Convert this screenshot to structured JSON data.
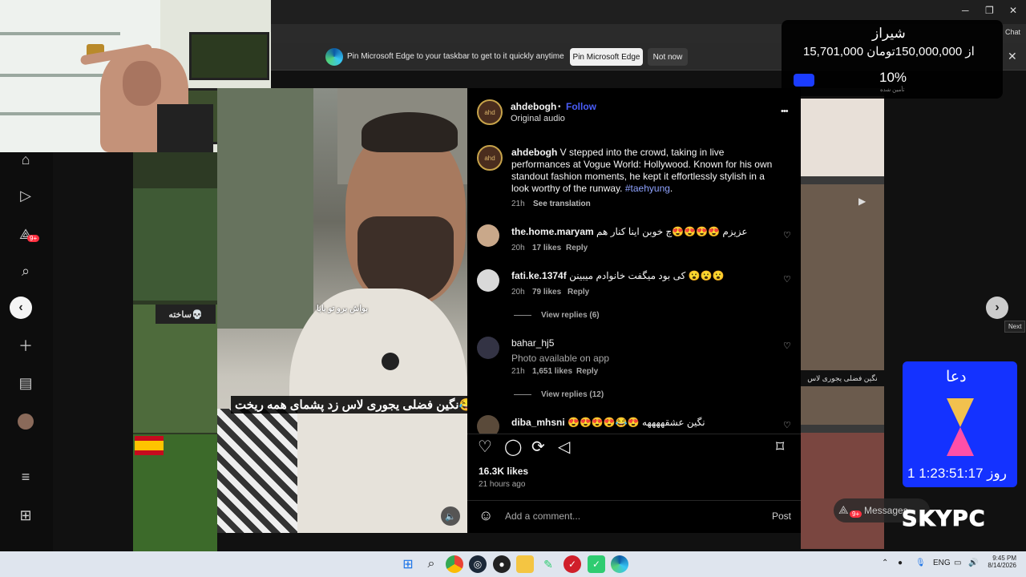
{
  "browser": {
    "edge_bar": {
      "message": "Pin Microsoft Edge to your taskbar to get to it quickly anytime",
      "pin_label": "Pin Microsoft Edge",
      "not_now_label": "Not now"
    },
    "chat_label": "Chat"
  },
  "nav": {
    "notification_badge": "9+",
    "left_arrow": "‹",
    "right_arrow": "›",
    "next_tooltip": "Next"
  },
  "video": {
    "small_caption": "بواش برو تو بابا",
    "main_caption": "نگین فضلی یجوری لاس زد پشمای همه ریخت😂🔥",
    "grid_overlay_text": "ساخته💀",
    "grid_overlay_text2": "نگین فضلی یجوری لاس"
  },
  "post": {
    "author": "ahdebogh",
    "follow_label": "Follow",
    "dot": "•",
    "audio": "Original audio",
    "more": "•••",
    "caption_text": "V stepped into the crowd, taking in live performances at Vogue World: Hollywood. Known for his own standout fashion moments, he kept it effortlessly stylish in a look worthy of the runway.",
    "hashtag": "#taehyung",
    "caption_end": ".",
    "caption_time": "21h",
    "see_translation": "See translation",
    "likes": "16.3K likes",
    "time_ago": "21 hours ago",
    "comment_placeholder": "Add a comment...",
    "post_label": "Post"
  },
  "comments": [
    {
      "user": "the.home.maryam",
      "text": "عزیزم 😍😍😍😍چ خوبن اینا کنار هم",
      "time": "20h",
      "likes": "17 likes",
      "reply": "Reply"
    },
    {
      "user": "fati.ke.1374f",
      "text": "کی بود میگفت خانوادم میبینن 😮😮😮",
      "time": "20h",
      "likes": "79 likes",
      "reply": "Reply",
      "view_replies": "View replies (6)"
    },
    {
      "user": "bahar_hj5",
      "text": "Photo available on app",
      "time": "21h",
      "likes": "1,651 likes",
      "reply": "Reply",
      "view_replies": "View replies (12)"
    },
    {
      "user": "diba_mhsni",
      "text": "😍😍😍😍😂😍 نگین عشقههههه"
    }
  ],
  "stream_overlay": {
    "city": "شیراز",
    "amount": "15,701,000 از 150,000,000تومان",
    "percent": "10%",
    "sub": "تأمین شده"
  },
  "prayer_widget": {
    "title": "دعا",
    "timer": "1 روز 1:23:51:17"
  },
  "messages_label": "Messages",
  "messages_badge": "9+",
  "watermark": "SKYPC",
  "taskbar": {
    "lang": "ENG",
    "time": "9:45 PM",
    "date": "8/14/2026"
  },
  "colors": {
    "accent_blue": "#4a5df9",
    "hashtag": "#8fa3ff",
    "overlay_blue": "#1432ff"
  }
}
